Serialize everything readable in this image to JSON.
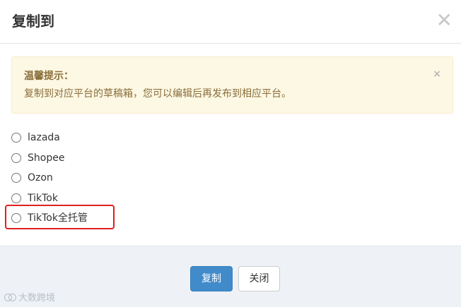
{
  "dialog": {
    "title": "复制到",
    "close_icon": "close-icon"
  },
  "alert": {
    "title": "温馨提示：",
    "message": "复制到对应平台的草稿箱，您可以编辑后再发布到相应平台。",
    "close_glyph": "×"
  },
  "options": [
    {
      "label": "lazada",
      "checked": false
    },
    {
      "label": "Shopee",
      "checked": false
    },
    {
      "label": "Ozon",
      "checked": false
    },
    {
      "label": "TikTok",
      "checked": false
    },
    {
      "label": "TikTok全托管",
      "checked": false,
      "highlighted": true
    }
  ],
  "footer": {
    "copy_button": "复制",
    "close_button": "关闭"
  },
  "watermark": {
    "text": "大数跨境"
  },
  "colors": {
    "primary": "#428bca",
    "alert_bg": "#fcf8e3",
    "alert_text": "#8a6d3b",
    "highlight_border": "#e0201d"
  }
}
